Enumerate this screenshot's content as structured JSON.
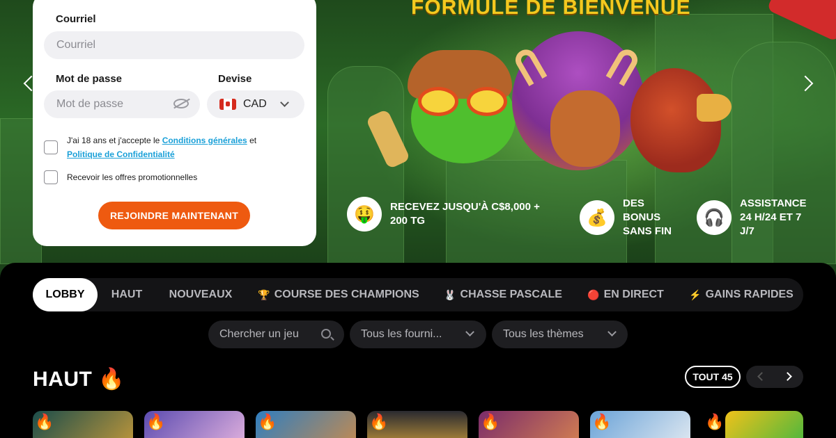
{
  "hero": {
    "title": "FORMULE DE BIENVENUE",
    "features": [
      {
        "icon": "money-face-icon",
        "glyph": "🤑",
        "text": "RECEVEZ JUSQU'À C$8,000 + 200 TG"
      },
      {
        "icon": "money-bag-icon",
        "glyph": "💰",
        "text": "DES BONUS SANS FIN"
      },
      {
        "icon": "headset-icon",
        "glyph": "🎧",
        "text": "ASSISTANCE 24 H/24 ET 7 J/7"
      }
    ]
  },
  "form": {
    "email_label": "Courriel",
    "email_placeholder": "Courriel",
    "password_label": "Mot de passe",
    "password_placeholder": "Mot de passe",
    "currency_label": "Devise",
    "currency_value": "CAD",
    "terms_prefix": "J'ai 18 ans et j'accepte le",
    "terms_link": "Conditions générales",
    "terms_and": "et",
    "privacy_link": "Politique de Confidentialité",
    "promo_text": "Recevoir les offres promotionnelles",
    "submit_label": "REJOINDRE MAINTENANT"
  },
  "tabs": [
    {
      "label": "LOBBY",
      "icon": "",
      "active": true
    },
    {
      "label": "HAUT",
      "icon": ""
    },
    {
      "label": "NOUVEAUX",
      "icon": ""
    },
    {
      "label": "COURSE DES CHAMPIONS",
      "icon": "🏆"
    },
    {
      "label": "CHASSE PASCALE",
      "icon": "🐰"
    },
    {
      "label": "EN DIRECT",
      "icon": "🔴"
    },
    {
      "label": "GAINS RAPIDES",
      "icon": "⚡"
    }
  ],
  "filters": {
    "search_placeholder": "Chercher un jeu",
    "providers": "Tous les fourni...",
    "themes": "Tous les thèmes"
  },
  "section": {
    "title": "HAUT",
    "title_icon": "🔥",
    "see_all": "TOUT 45"
  },
  "colors": {
    "accent": "#ee5a10",
    "link": "#1aa0d8",
    "hero_title": "#f3c91f"
  }
}
